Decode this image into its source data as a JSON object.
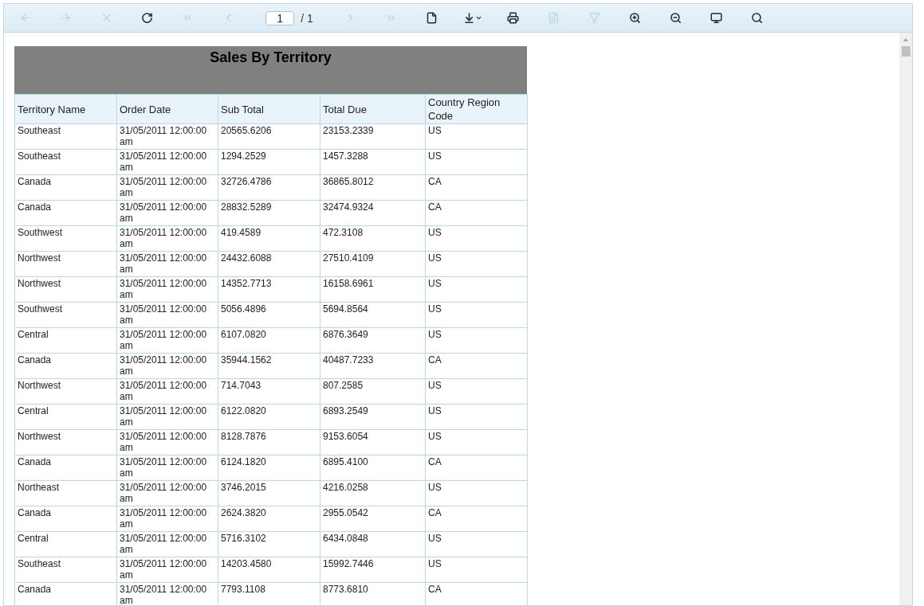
{
  "toolbar": {
    "tools_left": [
      {
        "kind": "back",
        "disabled": true
      },
      {
        "kind": "forward",
        "disabled": true
      },
      {
        "kind": "stop",
        "disabled": true
      },
      {
        "kind": "refresh",
        "disabled": false
      },
      {
        "kind": "first",
        "disabled": true
      },
      {
        "kind": "previous",
        "disabled": true
      }
    ],
    "page": {
      "value": "1",
      "total": "/ 1"
    },
    "tools_right": [
      {
        "kind": "next",
        "disabled": true
      },
      {
        "kind": "last",
        "disabled": true
      },
      {
        "kind": "document",
        "disabled": false
      },
      {
        "kind": "export",
        "disabled": false
      },
      {
        "kind": "print",
        "disabled": false
      },
      {
        "kind": "layout",
        "disabled": true
      },
      {
        "kind": "filter",
        "disabled": true
      },
      {
        "kind": "zoom-in",
        "disabled": false
      },
      {
        "kind": "zoom-out",
        "disabled": false
      },
      {
        "kind": "display",
        "disabled": false
      },
      {
        "kind": "search",
        "disabled": false
      }
    ]
  },
  "report": {
    "title": "Sales By Territory",
    "columns": [
      "Territory Name",
      "Order Date",
      "Sub Total",
      "Total Due",
      "Country Region Code"
    ],
    "rows": [
      [
        "Southeast",
        "31/05/2011 12:00:00 am",
        "20565.6206",
        "23153.2339",
        "US"
      ],
      [
        "Southeast",
        "31/05/2011 12:00:00 am",
        "1294.2529",
        "1457.3288",
        "US"
      ],
      [
        "Canada",
        "31/05/2011 12:00:00 am",
        "32726.4786",
        "36865.8012",
        "CA"
      ],
      [
        "Canada",
        "31/05/2011 12:00:00 am",
        "28832.5289",
        "32474.9324",
        "CA"
      ],
      [
        "Southwest",
        "31/05/2011 12:00:00 am",
        "419.4589",
        "472.3108",
        "US"
      ],
      [
        "Northwest",
        "31/05/2011 12:00:00 am",
        "24432.6088",
        "27510.4109",
        "US"
      ],
      [
        "Northwest",
        "31/05/2011 12:00:00 am",
        "14352.7713",
        "16158.6961",
        "US"
      ],
      [
        "Southwest",
        "31/05/2011 12:00:00 am",
        "5056.4896",
        "5694.8564",
        "US"
      ],
      [
        "Central",
        "31/05/2011 12:00:00 am",
        "6107.0820",
        "6876.3649",
        "US"
      ],
      [
        "Canada",
        "31/05/2011 12:00:00 am",
        "35944.1562",
        "40487.7233",
        "CA"
      ],
      [
        "Northwest",
        "31/05/2011 12:00:00 am",
        "714.7043",
        "807.2585",
        "US"
      ],
      [
        "Central",
        "31/05/2011 12:00:00 am",
        "6122.0820",
        "6893.2549",
        "US"
      ],
      [
        "Northwest",
        "31/05/2011 12:00:00 am",
        "8128.7876",
        "9153.6054",
        "US"
      ],
      [
        "Canada",
        "31/05/2011 12:00:00 am",
        "6124.1820",
        "6895.4100",
        "CA"
      ],
      [
        "Northeast",
        "31/05/2011 12:00:00 am",
        "3746.2015",
        "4216.0258",
        "US"
      ],
      [
        "Canada",
        "31/05/2011 12:00:00 am",
        "2624.3820",
        "2955.0542",
        "CA"
      ],
      [
        "Central",
        "31/05/2011 12:00:00 am",
        "5716.3102",
        "6434.0848",
        "US"
      ],
      [
        "Southeast",
        "31/05/2011 12:00:00 am",
        "14203.4580",
        "15992.7446",
        "US"
      ],
      [
        "Canada",
        "31/05/2011 12:00:00 am",
        "7793.1108",
        "8773.6810",
        "CA"
      ]
    ]
  }
}
